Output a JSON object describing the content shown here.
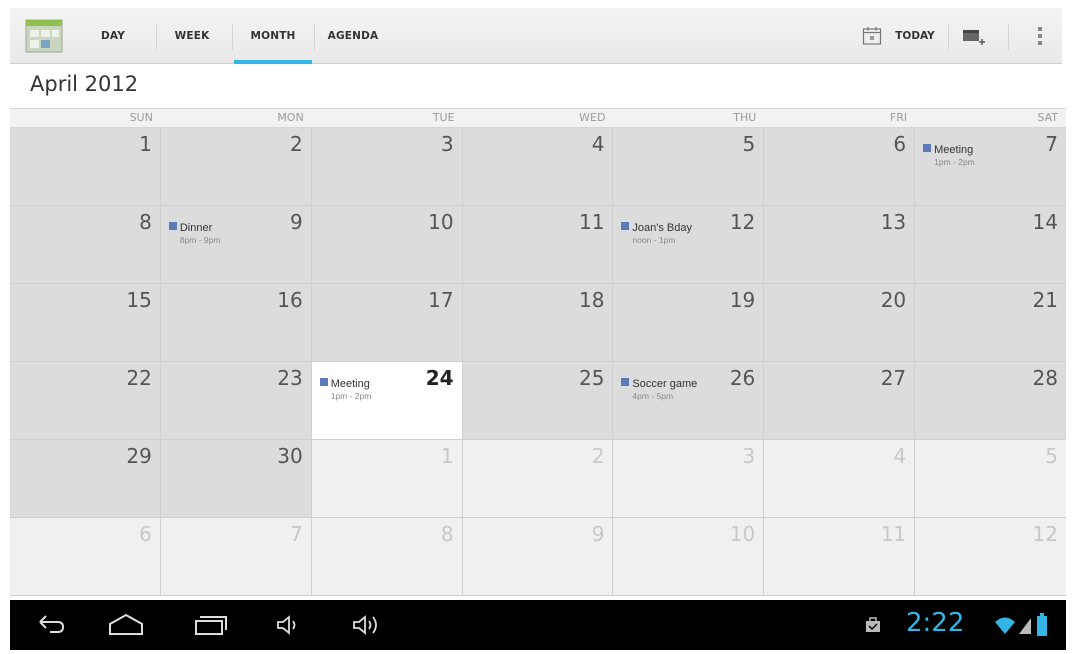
{
  "header": {
    "tabs": [
      {
        "label": "DAY",
        "selected": false
      },
      {
        "label": "WEEK",
        "selected": false
      },
      {
        "label": "MONTH",
        "selected": true
      },
      {
        "label": "AGENDA",
        "selected": false
      }
    ],
    "today_label": "TODAY",
    "accent_color": "#33b5e5"
  },
  "month_title": "April 2012",
  "weekdays": [
    "SUN",
    "MON",
    "TUE",
    "WED",
    "THU",
    "FRI",
    "SAT"
  ],
  "weeks": [
    [
      {
        "day": "1",
        "in_month": true
      },
      {
        "day": "2",
        "in_month": true
      },
      {
        "day": "3",
        "in_month": true
      },
      {
        "day": "4",
        "in_month": true
      },
      {
        "day": "5",
        "in_month": true
      },
      {
        "day": "6",
        "in_month": true
      },
      {
        "day": "7",
        "in_month": true,
        "event": {
          "title": "Meeting",
          "time": "1pm - 2pm"
        }
      }
    ],
    [
      {
        "day": "8",
        "in_month": true
      },
      {
        "day": "9",
        "in_month": true,
        "event": {
          "title": "Dinner",
          "time": "8pm - 9pm"
        }
      },
      {
        "day": "10",
        "in_month": true
      },
      {
        "day": "11",
        "in_month": true
      },
      {
        "day": "12",
        "in_month": true,
        "event": {
          "title": "Joan's Bday",
          "time": "noon - 1pm"
        }
      },
      {
        "day": "13",
        "in_month": true
      },
      {
        "day": "14",
        "in_month": true
      }
    ],
    [
      {
        "day": "15",
        "in_month": true
      },
      {
        "day": "16",
        "in_month": true
      },
      {
        "day": "17",
        "in_month": true
      },
      {
        "day": "18",
        "in_month": true
      },
      {
        "day": "19",
        "in_month": true
      },
      {
        "day": "20",
        "in_month": true
      },
      {
        "day": "21",
        "in_month": true
      }
    ],
    [
      {
        "day": "22",
        "in_month": true
      },
      {
        "day": "23",
        "in_month": true
      },
      {
        "day": "24",
        "in_month": true,
        "today": true,
        "event": {
          "title": "Meeting",
          "time": "1pm - 2pm"
        }
      },
      {
        "day": "25",
        "in_month": true
      },
      {
        "day": "26",
        "in_month": true,
        "event": {
          "title": "Soccer game",
          "time": "4pm - 5pm"
        }
      },
      {
        "day": "27",
        "in_month": true
      },
      {
        "day": "28",
        "in_month": true
      }
    ],
    [
      {
        "day": "29",
        "in_month": true
      },
      {
        "day": "30",
        "in_month": true
      },
      {
        "day": "1",
        "in_month": false
      },
      {
        "day": "2",
        "in_month": false
      },
      {
        "day": "3",
        "in_month": false
      },
      {
        "day": "4",
        "in_month": false
      },
      {
        "day": "5",
        "in_month": false
      }
    ],
    [
      {
        "day": "6",
        "in_month": false
      },
      {
        "day": "7",
        "in_month": false
      },
      {
        "day": "8",
        "in_month": false
      },
      {
        "day": "9",
        "in_month": false
      },
      {
        "day": "10",
        "in_month": false
      },
      {
        "day": "11",
        "in_month": false
      },
      {
        "day": "12",
        "in_month": false
      }
    ]
  ],
  "event_color": "#5d7ab8",
  "system_bar": {
    "clock": "2:22",
    "icons": [
      "back-icon",
      "home-icon",
      "recent-apps-icon",
      "volume-down-icon",
      "volume-up-icon",
      "notification-icon",
      "wifi-icon",
      "signal-icon",
      "battery-icon"
    ]
  }
}
